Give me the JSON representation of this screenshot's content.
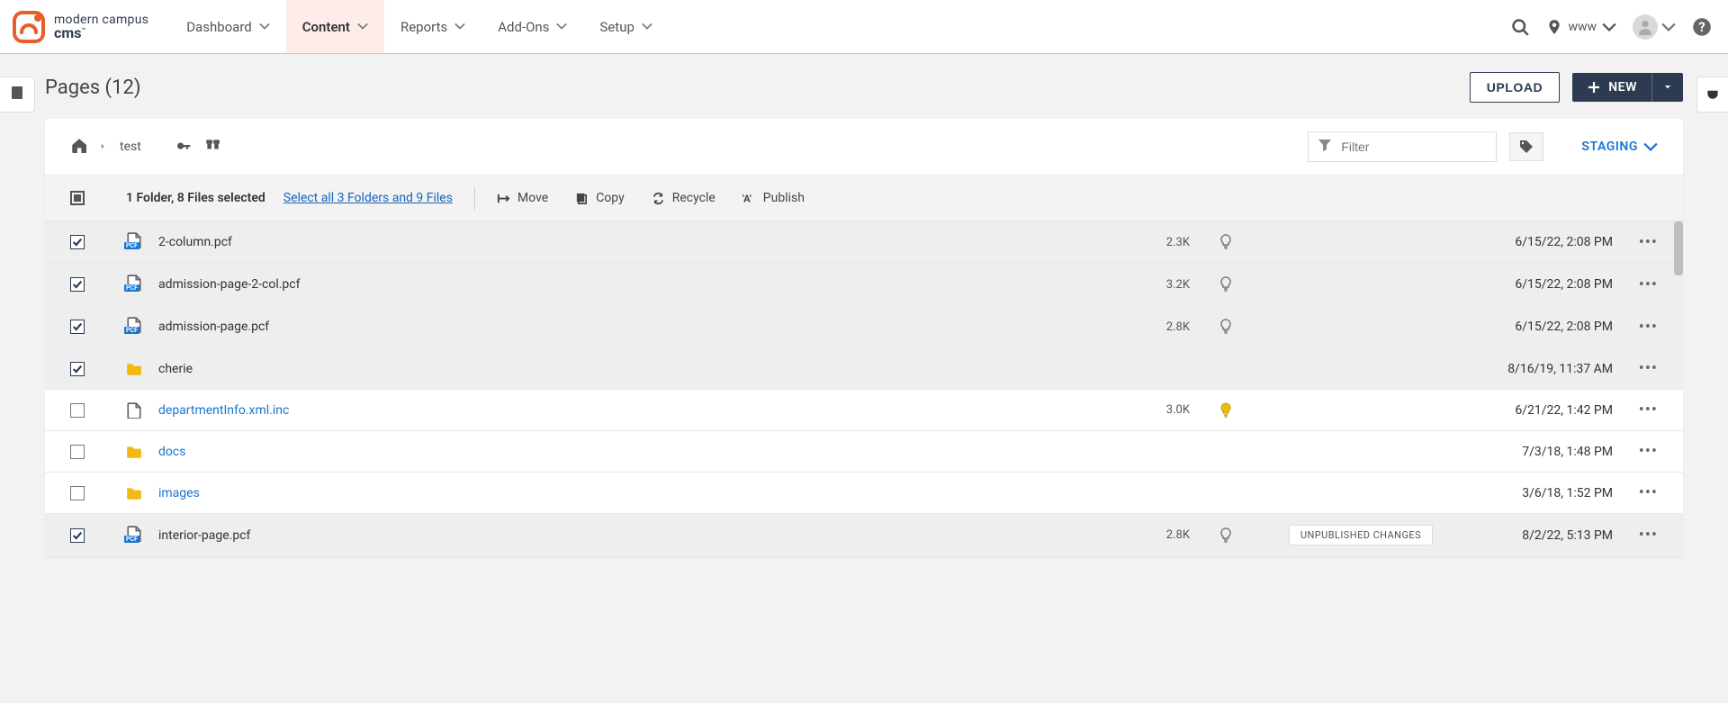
{
  "brand": {
    "top": "modern campus",
    "bottom": "cms",
    "tm": "™"
  },
  "nav": {
    "items": [
      "Dashboard",
      "Content",
      "Reports",
      "Add-Ons",
      "Setup"
    ],
    "active_index": 1,
    "www_label": "www"
  },
  "page": {
    "title": "Pages (12)",
    "upload_label": "UPLOAD",
    "new_label": "NEW"
  },
  "breadcrumb": {
    "item": "test"
  },
  "filter": {
    "placeholder": "Filter"
  },
  "staging": {
    "label": "STAGING"
  },
  "selection": {
    "summary": "1 Folder, 8 Files selected",
    "select_all": "Select all 3 Folders and 9 Files",
    "actions": {
      "move": "Move",
      "copy": "Copy",
      "recycle": "Recycle",
      "publish": "Publish"
    }
  },
  "rows": [
    {
      "name": "2-column.pcf",
      "type": "pcf",
      "selected": true,
      "size": "2.3K",
      "bulb": true,
      "lit": false,
      "badge": "",
      "date": "6/15/22, 2:08 PM"
    },
    {
      "name": "admission-page-2-col.pcf",
      "type": "pcf",
      "selected": true,
      "size": "3.2K",
      "bulb": true,
      "lit": false,
      "badge": "",
      "date": "6/15/22, 2:08 PM"
    },
    {
      "name": "admission-page.pcf",
      "type": "pcf",
      "selected": true,
      "size": "2.8K",
      "bulb": true,
      "lit": false,
      "badge": "",
      "date": "6/15/22, 2:08 PM"
    },
    {
      "name": "cherie",
      "type": "folder",
      "selected": true,
      "size": "",
      "bulb": false,
      "lit": false,
      "badge": "",
      "date": "8/16/19, 11:37 AM"
    },
    {
      "name": "departmentInfo.xml.inc",
      "type": "file",
      "selected": false,
      "size": "3.0K",
      "bulb": true,
      "lit": true,
      "badge": "",
      "date": "6/21/22, 1:42 PM"
    },
    {
      "name": "docs",
      "type": "folder",
      "selected": false,
      "size": "",
      "bulb": false,
      "lit": false,
      "badge": "",
      "date": "7/3/18, 1:48 PM"
    },
    {
      "name": "images",
      "type": "folder",
      "selected": false,
      "size": "",
      "bulb": false,
      "lit": false,
      "badge": "",
      "date": "3/6/18, 1:52 PM"
    },
    {
      "name": "interior-page.pcf",
      "type": "pcf",
      "selected": true,
      "size": "2.8K",
      "bulb": true,
      "lit": false,
      "badge": "UNPUBLISHED CHANGES",
      "date": "8/2/22, 5:13 PM"
    }
  ]
}
